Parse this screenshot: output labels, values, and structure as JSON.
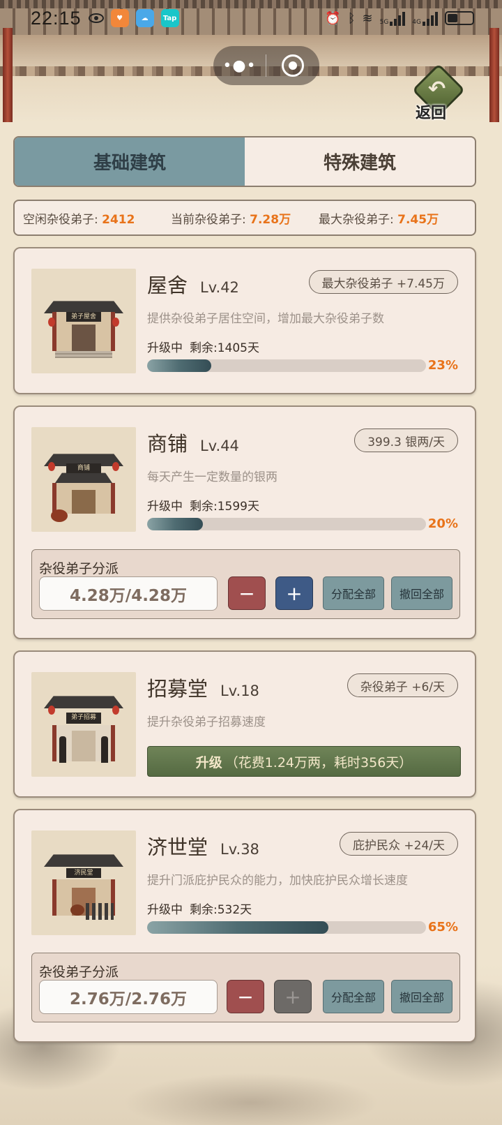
{
  "status_bar": {
    "time": "22:15",
    "app_badges": [
      {
        "icon": "heart-app-icon",
        "color": "#f2873a"
      },
      {
        "icon": "weather-app-icon",
        "color": "#4aa8e8"
      },
      {
        "icon": "taptap-app-icon",
        "color": "#19c6c9",
        "label": "Tap"
      }
    ],
    "network": [
      "5G",
      "4G"
    ]
  },
  "capsule": {
    "more": "•●•",
    "close_icon": "target-icon"
  },
  "back_button": {
    "label": "返回",
    "icon": "back-arrow-icon"
  },
  "tabs": [
    {
      "label": "基础建筑",
      "active": true
    },
    {
      "label": "特殊建筑",
      "active": false
    }
  ],
  "stats": {
    "idle_label": "空闲杂役弟子: ",
    "idle_value": "2412",
    "current_label": "当前杂役弟子: ",
    "current_value": "7.28万",
    "max_label": "最大杂役弟子: ",
    "max_value": "7.45万"
  },
  "buildings": [
    {
      "name": "屋舍",
      "level": "Lv.42",
      "tag": "最大杂役弟子 +7.45万",
      "desc": "提供杂役弟子居住空间，增加最大杂役弟子数",
      "state": "升级中",
      "remaining": "剩余:1405天",
      "progress_percent": 23,
      "progress_text": "23%",
      "plaque": "弟子屋舍"
    },
    {
      "name": "商铺",
      "level": "Lv.44",
      "tag": "399.3 银两/天",
      "desc": "每天产生一定数量的银两",
      "state": "升级中",
      "remaining": "剩余:1599天",
      "progress_percent": 20,
      "progress_text": "20%",
      "plaque": "商铺",
      "assign": {
        "title": "杂役弟子分派",
        "count": "4.28万/4.28万",
        "minus": "−",
        "plus": "+",
        "assign_all": "分配全部",
        "recall_all": "撤回全部"
      }
    },
    {
      "name": "招募堂",
      "level": "Lv.18",
      "tag": "杂役弟子 +6/天",
      "desc": "提升杂役弟子招募速度",
      "upgrade_label": "升级",
      "upgrade_cost": "（花费1.24万两，耗时356天）",
      "plaque": "弟子招募"
    },
    {
      "name": "济世堂",
      "level": "Lv.38",
      "tag": "庇护民众 +24/天",
      "desc": "提升门派庇护民众的能力，加快庇护民众增长速度",
      "state": "升级中",
      "remaining": "剩余:532天",
      "progress_percent": 65,
      "progress_text": "65%",
      "plaque": "济民堂",
      "assign": {
        "title": "杂役弟子分派",
        "count": "2.76万/2.76万",
        "minus": "−",
        "plus": "+",
        "plus_disabled": true,
        "assign_all": "分配全部",
        "recall_all": "撤回全部"
      }
    }
  ],
  "colors": {
    "accent_orange": "#e8731a",
    "tab_active": "#7a9aa1",
    "upgrade_green": "#556a42",
    "minus_red": "#a04f4f",
    "plus_blue": "#3e5a86"
  }
}
